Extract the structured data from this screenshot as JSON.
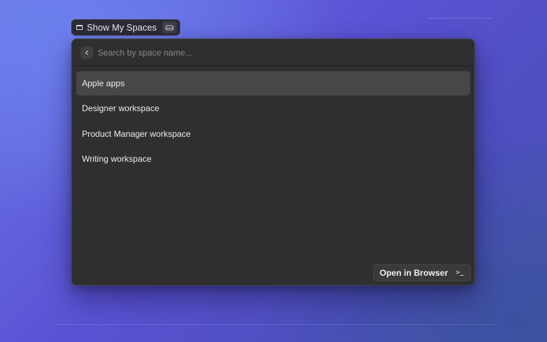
{
  "breadcrumb": {
    "label": "Show My Spaces",
    "folder_icon": "folder-icon",
    "shortcut_icon": "hard-drive-icon"
  },
  "search": {
    "placeholder": "Search by space name...",
    "value": "",
    "back_icon": "chevron-left-icon"
  },
  "spaces": [
    {
      "label": "Apple apps",
      "selected": true
    },
    {
      "label": "Designer workspace",
      "selected": false
    },
    {
      "label": "Product Manager workspace",
      "selected": false
    },
    {
      "label": "Writing workspace",
      "selected": false
    }
  ],
  "footer": {
    "action_label": "Open in Browser",
    "action_key": ">_",
    "action_icon": "terminal-prompt-icon"
  },
  "colors": {
    "panel": "#2f2f31",
    "selected_row": "#474749",
    "background_accent": "#5a52d4"
  }
}
